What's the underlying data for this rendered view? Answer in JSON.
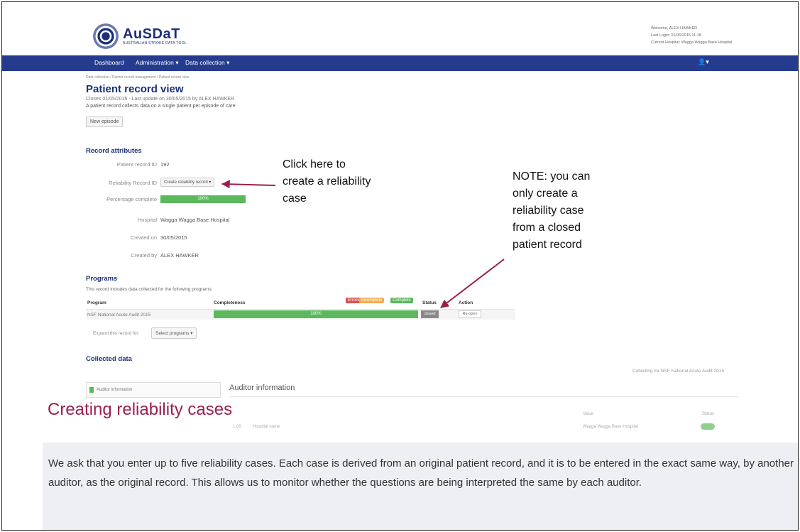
{
  "header": {
    "logo_name": "AuSDaT",
    "logo_sub": "AUSTRALIAN STROKE DATA TOOL",
    "welcome": "Welcome, ALEX HAWKER",
    "last_login": "Last Login: 01/06/2015 11:18",
    "current_hospital": "Current Hospital: Wagga Wagga Base Hospital"
  },
  "nav": {
    "dashboard": "Dashboard",
    "administration": "Administration ▾",
    "data_collection": "Data collection ▾",
    "user_menu": "👤▾"
  },
  "breadcrumb": "Data collection  /  Patient record management  /  Patient record view",
  "page": {
    "title": "Patient record view",
    "subtitle": "Closes 01/05/2015 - Last update on 30/05/2015 by ALEX HAWKER",
    "description": "A patient record collects data on a single patient per episode of care",
    "new_episode_button": "New episode"
  },
  "record_attributes": {
    "heading": "Record attributes",
    "patient_record_id_label": "Patient record ID",
    "patient_record_id": "192",
    "reliability_label": "Reliability Record ID",
    "reliability_button": "Create reliability record ▾",
    "percentage_label": "Percentage complete",
    "percentage_value": "100%",
    "percentage_fraction": 1.0,
    "hospital_label": "Hospital",
    "hospital": "Wagga Wagga Base Hospital",
    "created_on_label": "Created on",
    "created_on": "30/05/2015",
    "created_by_label": "Created by",
    "created_by": "ALEX HAWKER"
  },
  "programs": {
    "heading": "Programs",
    "intro": "This record includes data collected for the following programs:",
    "col_program": "Program",
    "col_completeness": "Completeness",
    "tag_errors": "Errors",
    "tag_incomplete": "Incomplete",
    "tag_complete": "Complete",
    "col_status": "Status",
    "col_action": "Action",
    "row_program": "NSF National Acute Audit 2015",
    "row_completeness": "100%",
    "row_status": "closed",
    "row_action": "Re-open",
    "expand_label": "Expand this record for:",
    "select_programs_button": "Select programs ▾"
  },
  "collected": {
    "heading": "Collected data",
    "collecting_for": "Collecting for NSF National Acute Audit 2015",
    "sidebar_item": "Auditor information",
    "panel_title": "Auditor information",
    "col_value": "Value",
    "col_status": "Status",
    "row_num": "1.00",
    "row_label": "Hospital name",
    "row_value": "Wagga Wagga Base Hospital"
  },
  "annotations": {
    "click_here_1": "Click here to",
    "click_here_2": "create a reliability",
    "click_here_3": "case",
    "note_1": "NOTE: you can",
    "note_2": "only create a",
    "note_3": "reliability case",
    "note_4": "from a closed",
    "note_5": "patient record"
  },
  "section": {
    "title": "Creating reliability cases",
    "body": "We ask that you enter up to five reliability cases. Each case is derived from an original patient record, and it is to be entered in the exact same way, by another auditor, as the original record. This allows us to monitor whether the questions are being interpreted the same by each auditor."
  },
  "colors": {
    "navbar": "#253c8e",
    "brand": "#1c2f7a",
    "success": "#5cb85c",
    "error": "#d9534f",
    "warning": "#f0ad4e",
    "heading_accent": "#9b1f4e",
    "note_bg": "#edeff3"
  }
}
